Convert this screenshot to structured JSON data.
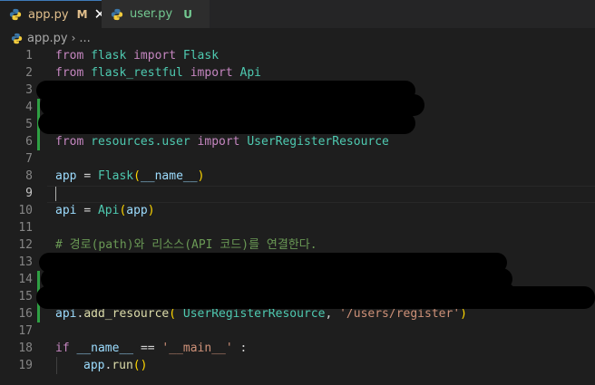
{
  "tabs": [
    {
      "label": "app.py",
      "badge": "M",
      "active": true
    },
    {
      "label": "user.py",
      "badge": "U",
      "active": false
    }
  ],
  "breadcrumb": {
    "file": "app.py",
    "separator": "›",
    "rest": "..."
  },
  "colors": {
    "modified": "#e2c08d",
    "untracked": "#73c991",
    "git_added_gutter": "#2ea043",
    "editor_bg": "#1e1e1e"
  },
  "icons": {
    "python": "python-file-icon",
    "close": "close-icon"
  },
  "code": {
    "line_numbers": [
      "1",
      "2",
      "3",
      "4",
      "5",
      "6",
      "7",
      "8",
      "9",
      "10",
      "11",
      "12",
      "13",
      "14",
      "15",
      "16",
      "17",
      "18",
      "19"
    ],
    "current_line": "9",
    "l1": [
      "from",
      "flask",
      "import",
      "Flask"
    ],
    "l2": [
      "from",
      "flask_restful",
      "import",
      "Api"
    ],
    "l6": [
      "from",
      "resources.user",
      "import",
      "UserRegisterResource"
    ],
    "l8": [
      "app",
      "=",
      "Flask",
      "(",
      "__name__",
      ")"
    ],
    "l10": [
      "api",
      "=",
      "Api",
      "(",
      "app",
      ")"
    ],
    "l12": "# 경로(path)와 리소스(API 코드)를 연결한다.",
    "l16": [
      "api",
      ".",
      "add_resource",
      "(",
      "UserRegisterResource",
      ",",
      "'/users/register'",
      ")"
    ],
    "l18": [
      "if",
      "__name__",
      "==",
      "'__main__'",
      ":"
    ],
    "l19": [
      "app",
      ".",
      "run",
      "()"
    ]
  }
}
